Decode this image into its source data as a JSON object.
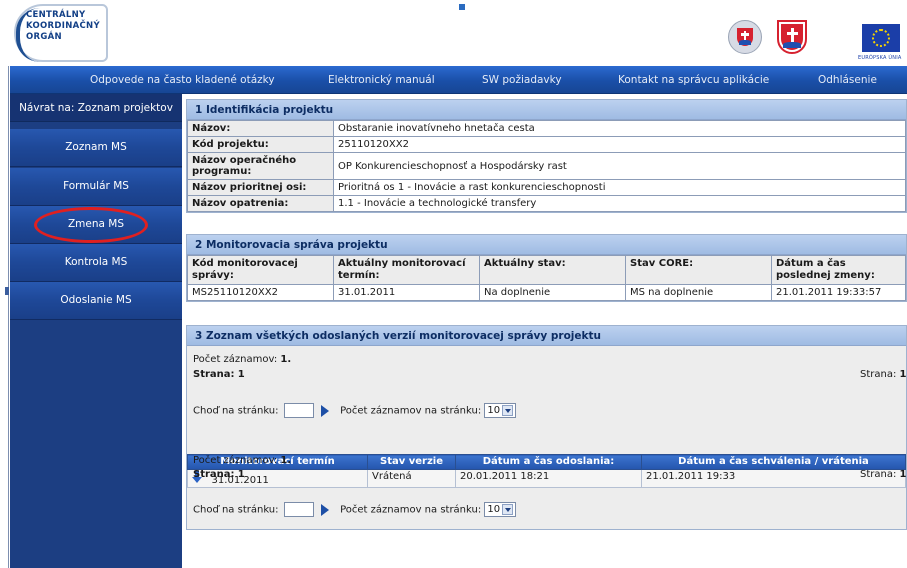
{
  "header": {
    "logo_line1": "Centrálny",
    "logo_line2": "Koordinačný",
    "logo_line3": "Orgán",
    "eu_caption": "EURÓPSKA ÚNIA"
  },
  "topnav": {
    "items": [
      "Odpovede na často kladené otázky",
      "Elektronický manuál",
      "SW požiadavky",
      "Kontakt na správcu aplikácie",
      "Odhlásenie"
    ]
  },
  "sidebar": {
    "back_label": "Návrat na: Zoznam projektov",
    "items": [
      "Zoznam MS",
      "Formulár MS",
      "Zmena MS",
      "Kontrola MS",
      "Odoslanie MS"
    ],
    "highlighted": "Zmena MS",
    "highlight_color": "#e02020"
  },
  "section1": {
    "title": "1 Identifikácia projektu",
    "rows": [
      {
        "label": "Názov:",
        "value": "Obstaranie inovatívneho hnetača cesta"
      },
      {
        "label": "Kód projektu:",
        "value": "25110120XX2"
      },
      {
        "label": "Názov operačného programu:",
        "value": "OP Konkurencieschopnosť a Hospodársky rast"
      },
      {
        "label": "Názov prioritnej osi:",
        "value": "Prioritná os 1 - Inovácie a rast konkurencieschopnosti"
      },
      {
        "label": "Názov opatrenia:",
        "value": "1.1 - Inovácie a technologické transfery"
      }
    ]
  },
  "section2": {
    "title": "2 Monitorovacia správa projektu",
    "headers": [
      "Kód monitorovacej správy:",
      "Aktuálny monitorovací termín:",
      "Aktuálny stav:",
      "Stav CORE:",
      "Dátum a čas poslednej zmeny:"
    ],
    "row": [
      "MS25110120XX2",
      "31.01.2011",
      "Na doplnenie",
      "MS na doplnenie",
      "21.01.2011 19:33:57"
    ]
  },
  "section3": {
    "title": "3 Zoznam všetkých odoslaných verzií monitorovacej správy projektu",
    "count_label": "Počet záznamov:",
    "count_value": "1.",
    "page_label": "Strana:",
    "page_value": "1",
    "goto_label": "Choď na stránku:",
    "per_page_label": "Počet záznamov na stránku:",
    "per_page_value": "10",
    "table_headers": [
      "Monitorovací termín",
      "Stav verzie",
      "Dátum a čas odoslania:",
      "Dátum a čas schválenia / vrátenia"
    ],
    "rows": [
      {
        "term": "31.01.2011",
        "state": "Vrátená",
        "sent": "20.01.2011 18:21",
        "approved": "21.01.2011 19:33"
      }
    ]
  }
}
